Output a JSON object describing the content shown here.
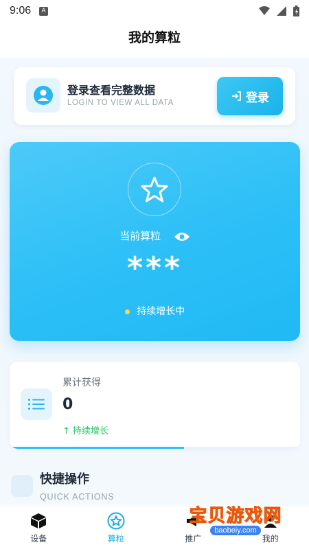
{
  "status_bar": {
    "time": "9:06",
    "badge": "A"
  },
  "header": {
    "title": "我的算粒"
  },
  "login_card": {
    "title": "登录查看完整数据",
    "subtitle": "LOGIN TO VIEW ALL DATA",
    "button_label": "登录"
  },
  "power_card": {
    "label": "当前算粒",
    "value": "***",
    "status": "持续增长中"
  },
  "stats_card": {
    "label": "累计获得",
    "value": "0",
    "trend": "↑ 持续增长",
    "progress": 0.6
  },
  "quick_actions": {
    "title": "快捷操作",
    "subtitle": "QUICK ACTIONS"
  },
  "tabbar": {
    "items": [
      {
        "label": "设备",
        "icon": "cube-icon"
      },
      {
        "label": "算粒",
        "icon": "star-circle-icon",
        "active": true
      },
      {
        "label": "推广",
        "icon": "megaphone-icon"
      },
      {
        "label": "我的",
        "icon": "user-icon"
      }
    ]
  },
  "watermark": {
    "text": "宝贝游戏网",
    "url": "baobeiy.com"
  },
  "colors": {
    "accent": "#20b9f4",
    "trend": "#22c55e",
    "status_dot": "#ffd84a"
  }
}
